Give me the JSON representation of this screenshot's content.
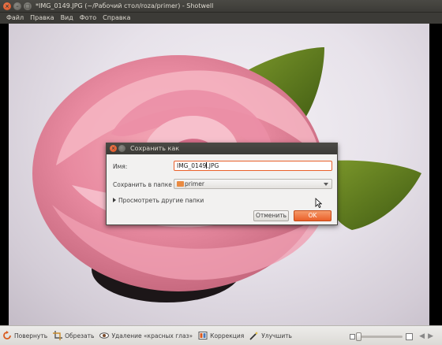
{
  "window": {
    "title": "*IMG_0149.JPG (~/Рабочий стол/roza/primer) - Shotwell"
  },
  "menu": [
    "Файл",
    "Правка",
    "Вид",
    "Фото",
    "Справка"
  ],
  "dialog": {
    "title": "Сохранить как",
    "name_label": "Имя:",
    "name_value_before_cursor": "IMG_0149",
    "name_value_after_cursor": ".JPG",
    "folder_label": "Сохранить в папке",
    "folder_value": "primer",
    "expander_label": "Просмотреть другие папки",
    "cancel_label": "Отменить",
    "ok_label": "OK"
  },
  "toolbar": {
    "rotate_label": "Повернуть",
    "crop_label": "Обрезать",
    "redeye_label": "Удаление «красных глаз»",
    "adjust_label": "Коррекция",
    "enhance_label": "Улучшить"
  },
  "zoom": {
    "level_fraction": 0.0
  },
  "colors": {
    "accent": "#e9602a",
    "titlebar": "#3c3b37"
  }
}
